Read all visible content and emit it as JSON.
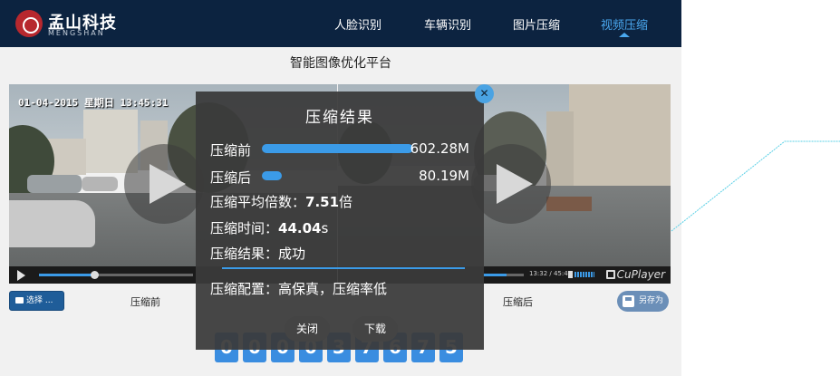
{
  "header": {
    "brand_cn": "孟山科技",
    "brand_en": "MENGSHAN",
    "nav": [
      {
        "label": "人脸识别",
        "active": false
      },
      {
        "label": "车辆识别",
        "active": false
      },
      {
        "label": "图片压缩",
        "active": false
      },
      {
        "label": "视频压缩",
        "active": true
      }
    ]
  },
  "page": {
    "title": "智能图像优化平台"
  },
  "video_left": {
    "osd": "01-04-2015 星期日 13:45:31",
    "caption": "压缩前",
    "progress": 0.36
  },
  "video_right": {
    "timecode": "13:32 / 45:45",
    "player_name": "CuPlayer",
    "caption": "压缩后",
    "progress": 0.58
  },
  "controls": {
    "select_label": "选择 ...",
    "saveas_label": "另存为"
  },
  "counter": {
    "digits": [
      "0",
      "0",
      "0",
      "0",
      "3",
      "7",
      "6",
      "7",
      "5"
    ]
  },
  "modal": {
    "title": "压缩结果",
    "before_label": "压缩前",
    "before_value": "602.28M",
    "after_label": "压缩后",
    "after_value": "80.19M",
    "after_ratio": 0.133,
    "ratio_label": "压缩平均倍数：",
    "ratio_value": "7.51",
    "ratio_unit": "倍",
    "time_label": "压缩时间：",
    "time_value": "44.04",
    "time_unit": "s",
    "result_label": "压缩结果：",
    "result_value": "成功",
    "config_text": "压缩配置：高保真，压缩率低",
    "close_button": "关闭",
    "download_button": "下载",
    "close_icon": "close-icon"
  },
  "colors": {
    "header_bg": "#0c2340",
    "accent": "#3b9be8",
    "modal_bg": "#3a3a3a"
  }
}
